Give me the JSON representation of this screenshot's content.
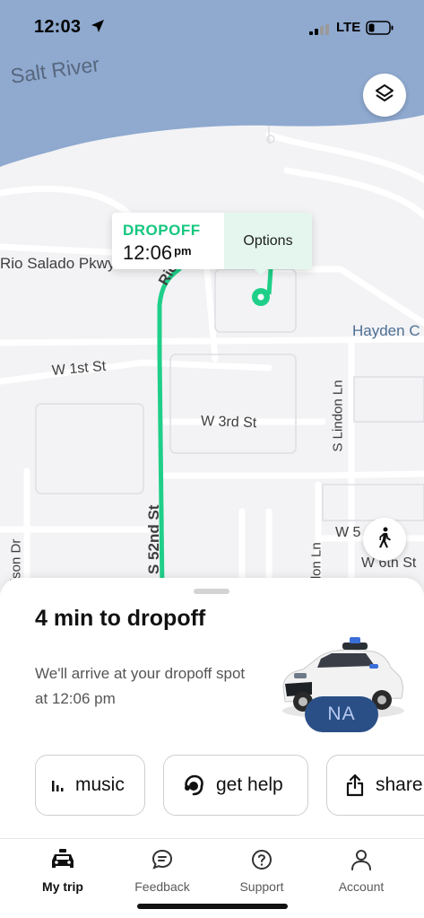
{
  "status_bar": {
    "time": "12:03",
    "network": "LTE"
  },
  "map": {
    "river_label": "Salt River",
    "streets": {
      "rio_salado": "Rio Salado Pkwy",
      "rio_diag": "Rio",
      "w_1st": "W 1st St",
      "w_3rd": "W 3rd St",
      "s_52nd": "S 52nd St",
      "s_lindon": "S Lindon Ln",
      "lindon_ln_lower": "ndon Ln",
      "hayden": "Hayden C",
      "madison": "dison Dr",
      "w_5": "W 5",
      "w_6th": "W 6th St"
    },
    "route_color": "#1fcf89",
    "water_color": "#8fa9cf"
  },
  "callout": {
    "title": "DROPOFF",
    "time": "12:06",
    "ampm": "pm",
    "options_label": "Options"
  },
  "trip": {
    "eta_title": "4 min to dropoff",
    "eta_description": "We'll arrive at your dropoff spot at 12:06 pm",
    "vehicle_badge": "NA"
  },
  "actions": [
    {
      "label": "music",
      "icon": "music-bars-icon"
    },
    {
      "label": "get help",
      "icon": "headset-icon"
    },
    {
      "label": "share",
      "icon": "share-icon"
    }
  ],
  "tabs": [
    {
      "label": "My trip",
      "icon": "car-icon",
      "active": true
    },
    {
      "label": "Feedback",
      "icon": "chat-bubble-icon",
      "active": false
    },
    {
      "label": "Support",
      "icon": "question-circle-icon",
      "active": false
    },
    {
      "label": "Account",
      "icon": "person-icon",
      "active": false
    }
  ]
}
